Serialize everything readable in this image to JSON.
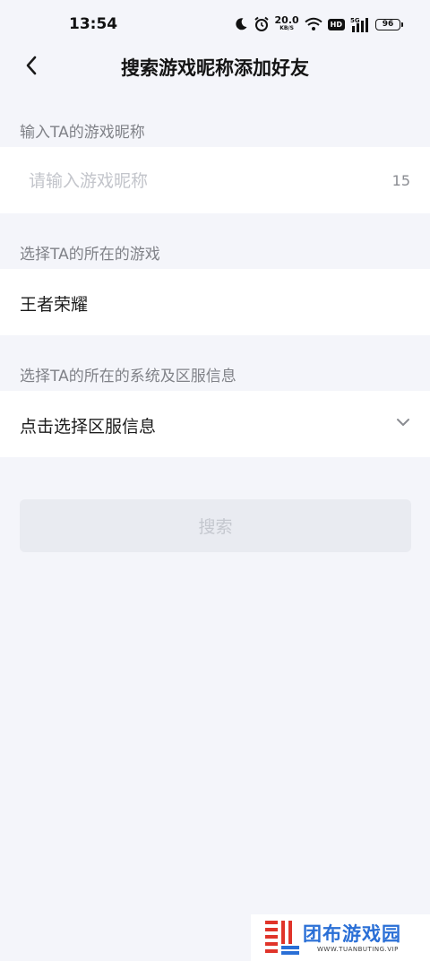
{
  "status_bar": {
    "time": "13:54",
    "net_speed_value": "20.0",
    "net_speed_unit": "KB/S",
    "hd_badge": "HD",
    "signal_label": "5G",
    "battery_level": "96",
    "icons": [
      "moon-icon",
      "alarm-icon",
      "wifi-icon",
      "hd-icon",
      "signal-icon",
      "battery-icon"
    ]
  },
  "header": {
    "title": "搜索游戏昵称添加好友",
    "back_icon": "chevron-left-icon"
  },
  "form": {
    "nickname_label": "输入TA的游戏昵称",
    "nickname_placeholder": "请输入游戏昵称",
    "nickname_value": "",
    "nickname_char_limit": "15",
    "game_label": "选择TA的所在的游戏",
    "game_value": "王者荣耀",
    "server_label": "选择TA的所在的系统及区服信息",
    "server_value": "点击选择区服信息",
    "server_icon": "chevron-down-icon",
    "search_button": "搜索"
  },
  "watermark": {
    "name": "团布游戏园",
    "url": "WWW.TUANBUTING.VIP"
  },
  "colors": {
    "page_background": "#f4f5fa",
    "card_background": "#ffffff",
    "label_gray": "#808288",
    "placeholder_gray": "#c3c5cb",
    "disabled_button_bg": "#e9ebf1",
    "disabled_button_text": "#c5c8cf",
    "watermark_blue": "#2a6fd6",
    "watermark_red": "#e0342a"
  }
}
